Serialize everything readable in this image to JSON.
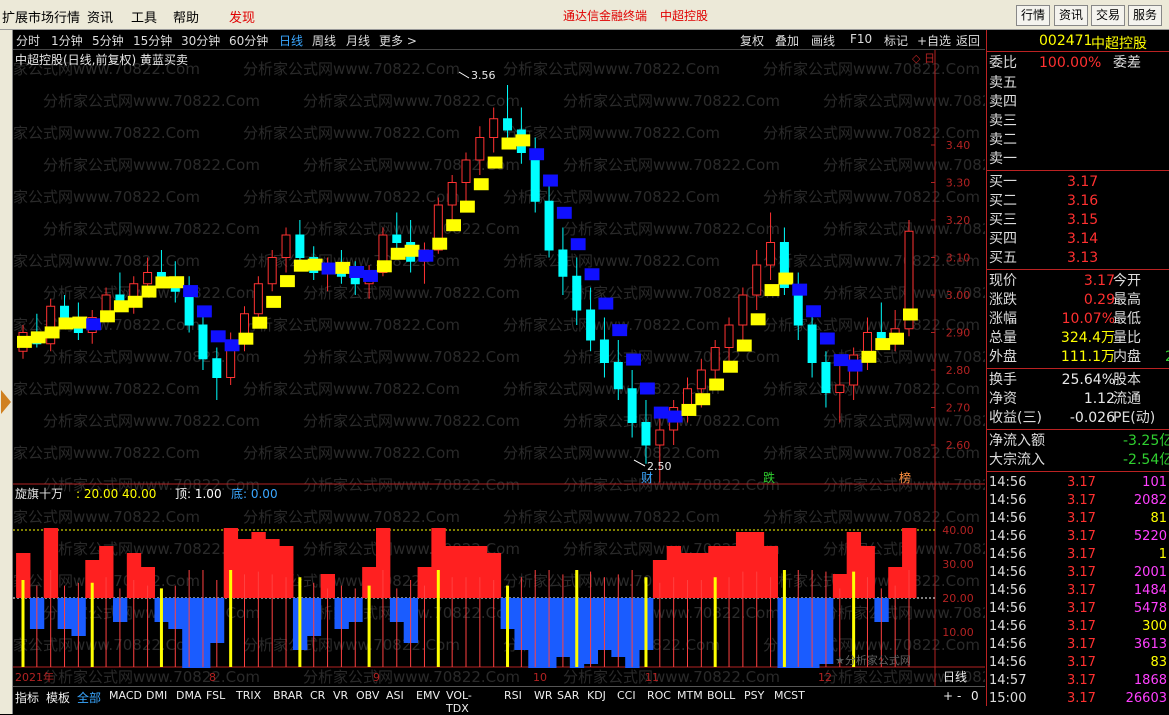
{
  "menu": {
    "items": [
      "扩展市场行情",
      "资讯",
      "工具",
      "帮助",
      "发现"
    ],
    "center_links": [
      "通达信金融终端",
      "中超控股"
    ],
    "right_buttons": [
      "行情",
      "资讯",
      "交易",
      "服务"
    ]
  },
  "periods": {
    "items": [
      "分时",
      "1分钟",
      "5分钟",
      "15分钟",
      "30分钟",
      "60分钟",
      "日线",
      "周线",
      "月线",
      "更多 >"
    ],
    "active": "日线",
    "right_tools": [
      "复权",
      "叠加",
      "画线",
      "F10",
      "标记",
      "+自选",
      "返回"
    ]
  },
  "chart": {
    "title": "中超控股(日线,前复权) 黄蓝买卖",
    "high_label": "3.56",
    "low_label": "2.50",
    "event_markers": [
      "财",
      "跌",
      "榜"
    ],
    "watermark": "分析家公式网www.70822.Com",
    "corner_watermark": "★分析家公式网"
  },
  "indicator": {
    "name": "旋旗十万",
    "params": ": 20.00  40.00",
    "top_label": "顶: 1.00",
    "bottom_label": "底: 0.00",
    "y_ticks": [
      "40.00",
      "30.00",
      "20.00",
      "10.00"
    ]
  },
  "date_axis": [
    "2021年",
    "8",
    "9",
    "10",
    "11",
    "12"
  ],
  "period_label": "日线",
  "bottom_tabs": {
    "left": [
      "指标",
      "模板"
    ],
    "active": "全部",
    "items": [
      "MACD",
      "DMI",
      "DMA",
      "FSL",
      "TRIX",
      "BRAR",
      "CR",
      "VR",
      "OBV",
      "ASI",
      "EMV",
      "VOL-TDX",
      "RSI",
      "WR",
      "SAR",
      "KDJ",
      "CCI",
      "ROC",
      "MTM",
      "BOLL",
      "PSY",
      "MCST"
    ],
    "controls": [
      "+",
      "-",
      "0"
    ]
  },
  "quote": {
    "code": "002471",
    "name": "中超控股",
    "weibi_label": "委比",
    "weibi_value": "100.00%",
    "weicha_label": "委差",
    "sell": [
      {
        "label": "卖五",
        "price": ""
      },
      {
        "label": "卖四",
        "price": ""
      },
      {
        "label": "卖三",
        "price": ""
      },
      {
        "label": "卖二",
        "price": ""
      },
      {
        "label": "卖一",
        "price": ""
      }
    ],
    "buy": [
      {
        "label": "买一",
        "price": "3.17"
      },
      {
        "label": "买二",
        "price": "3.16"
      },
      {
        "label": "买三",
        "price": "3.15"
      },
      {
        "label": "买四",
        "price": "3.14"
      },
      {
        "label": "买五",
        "price": "3.13"
      }
    ],
    "stats": [
      {
        "l1": "现价",
        "v1": "3.17",
        "l2": "今开"
      },
      {
        "l1": "涨跌",
        "v1": "0.29",
        "l2": "最高"
      },
      {
        "l1": "涨幅",
        "v1": "10.07%",
        "l2": "最低"
      },
      {
        "l1": "总量",
        "v1": "324.4万",
        "l2": "量比"
      },
      {
        "l1": "外盘",
        "v1": "111.1万",
        "l2": "内盘",
        "v2": "2"
      }
    ],
    "stats2": [
      {
        "l1": "换手",
        "v1": "25.64%",
        "l2": "股本"
      },
      {
        "l1": "净资",
        "v1": "1.12",
        "l2": "流通"
      },
      {
        "l1": "收益(三)",
        "v1": "-0.026",
        "l2": "PE(动)"
      }
    ],
    "flows": [
      {
        "label": "净流入额",
        "value": "-3.25亿"
      },
      {
        "label": "大宗流入",
        "value": "-2.54亿"
      }
    ],
    "ticks": [
      {
        "time": "14:56",
        "price": "3.17",
        "vol": "101",
        "c": "#ff40ff"
      },
      {
        "time": "14:56",
        "price": "3.17",
        "vol": "2082",
        "c": "#ff40ff"
      },
      {
        "time": "14:56",
        "price": "3.17",
        "vol": "81",
        "c": "#ffff00"
      },
      {
        "time": "14:56",
        "price": "3.17",
        "vol": "5220",
        "c": "#ff40ff"
      },
      {
        "time": "14:56",
        "price": "3.17",
        "vol": "1",
        "c": "#ffff00"
      },
      {
        "time": "14:56",
        "price": "3.17",
        "vol": "2001",
        "c": "#ff40ff"
      },
      {
        "time": "14:56",
        "price": "3.17",
        "vol": "1484",
        "c": "#ff40ff"
      },
      {
        "time": "14:56",
        "price": "3.17",
        "vol": "5478",
        "c": "#ff40ff"
      },
      {
        "time": "14:56",
        "price": "3.17",
        "vol": "300",
        "c": "#ffff00"
      },
      {
        "time": "14:56",
        "price": "3.17",
        "vol": "3613",
        "c": "#ff40ff"
      },
      {
        "time": "14:56",
        "price": "3.17",
        "vol": "83",
        "c": "#ffff00"
      },
      {
        "time": "14:57",
        "price": "3.17",
        "vol": "1868",
        "c": "#ff40ff"
      },
      {
        "time": "15:00",
        "price": "3.17",
        "vol": "26603",
        "c": "#ff40ff"
      }
    ]
  },
  "chart_data": {
    "type": "candlestick",
    "y_ticks": [
      "3.40",
      "3.30",
      "3.20",
      "3.10",
      "3.00",
      "2.90",
      "2.80",
      "2.70",
      "2.60"
    ],
    "ylim": [
      2.56,
      3.6
    ],
    "candles_ohlc": [
      [
        2.85,
        2.92,
        2.83,
        2.9
      ],
      [
        2.9,
        2.95,
        2.86,
        2.87
      ],
      [
        2.87,
        2.99,
        2.85,
        2.97
      ],
      [
        2.97,
        3.0,
        2.92,
        2.94
      ],
      [
        2.94,
        2.98,
        2.88,
        2.9
      ],
      [
        2.9,
        2.96,
        2.87,
        2.94
      ],
      [
        2.94,
        3.02,
        2.93,
        3.0
      ],
      [
        3.0,
        3.06,
        2.96,
        2.98
      ],
      [
        2.98,
        3.05,
        2.95,
        3.03
      ],
      [
        3.03,
        3.1,
        3.0,
        3.06
      ],
      [
        3.06,
        3.12,
        3.02,
        3.04
      ],
      [
        3.04,
        3.09,
        2.98,
        3.01
      ],
      [
        3.01,
        3.05,
        2.9,
        2.92
      ],
      [
        2.92,
        2.95,
        2.8,
        2.83
      ],
      [
        2.83,
        2.86,
        2.72,
        2.78
      ],
      [
        2.78,
        2.9,
        2.76,
        2.88
      ],
      [
        2.88,
        2.97,
        2.85,
        2.95
      ],
      [
        2.95,
        3.05,
        2.93,
        3.03
      ],
      [
        3.03,
        3.12,
        3.01,
        3.1
      ],
      [
        3.1,
        3.18,
        3.06,
        3.16
      ],
      [
        3.16,
        3.2,
        3.08,
        3.1
      ],
      [
        3.1,
        3.13,
        3.04,
        3.06
      ],
      [
        3.06,
        3.1,
        3.01,
        3.08
      ],
      [
        3.08,
        3.12,
        3.03,
        3.05
      ],
      [
        3.05,
        3.09,
        3.0,
        3.03
      ],
      [
        3.03,
        3.08,
        2.99,
        3.06
      ],
      [
        3.06,
        3.18,
        3.05,
        3.16
      ],
      [
        3.16,
        3.22,
        3.1,
        3.14
      ],
      [
        3.14,
        3.2,
        3.06,
        3.09
      ],
      [
        3.09,
        3.14,
        3.03,
        3.12
      ],
      [
        3.12,
        3.26,
        3.11,
        3.24
      ],
      [
        3.24,
        3.32,
        3.2,
        3.3
      ],
      [
        3.3,
        3.38,
        3.24,
        3.36
      ],
      [
        3.36,
        3.45,
        3.32,
        3.42
      ],
      [
        3.42,
        3.5,
        3.38,
        3.47
      ],
      [
        3.47,
        3.56,
        3.4,
        3.44
      ],
      [
        3.44,
        3.5,
        3.35,
        3.38
      ],
      [
        3.38,
        3.42,
        3.22,
        3.25
      ],
      [
        3.25,
        3.3,
        3.1,
        3.12
      ],
      [
        3.12,
        3.18,
        3.0,
        3.05
      ],
      [
        3.05,
        3.1,
        2.92,
        2.96
      ],
      [
        2.96,
        3.02,
        2.85,
        2.88
      ],
      [
        2.88,
        2.94,
        2.78,
        2.82
      ],
      [
        2.82,
        2.88,
        2.72,
        2.75
      ],
      [
        2.75,
        2.8,
        2.62,
        2.66
      ],
      [
        2.66,
        2.72,
        2.55,
        2.6
      ],
      [
        2.6,
        2.68,
        2.5,
        2.64
      ],
      [
        2.64,
        2.72,
        2.6,
        2.7
      ],
      [
        2.7,
        2.78,
        2.66,
        2.75
      ],
      [
        2.75,
        2.83,
        2.7,
        2.8
      ],
      [
        2.8,
        2.88,
        2.76,
        2.86
      ],
      [
        2.86,
        2.94,
        2.82,
        2.92
      ],
      [
        2.92,
        3.02,
        2.88,
        3.0
      ],
      [
        3.0,
        3.12,
        2.96,
        3.08
      ],
      [
        3.08,
        3.22,
        3.04,
        3.14
      ],
      [
        3.14,
        3.18,
        3.0,
        3.02
      ],
      [
        3.02,
        3.06,
        2.88,
        2.92
      ],
      [
        2.92,
        2.96,
        2.78,
        2.82
      ],
      [
        2.82,
        2.85,
        2.7,
        2.74
      ],
      [
        2.74,
        2.82,
        2.66,
        2.76
      ],
      [
        2.76,
        2.86,
        2.72,
        2.84
      ],
      [
        2.84,
        2.94,
        2.8,
        2.9
      ],
      [
        2.9,
        2.98,
        2.86,
        2.88
      ],
      [
        2.88,
        2.96,
        2.85,
        2.91
      ],
      [
        2.91,
        3.2,
        2.89,
        3.17
      ]
    ]
  }
}
